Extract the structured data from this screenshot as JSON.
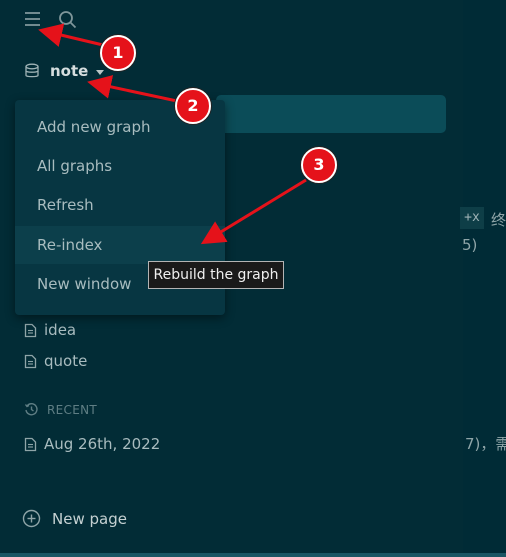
{
  "sidebar": {
    "graph_name": "note",
    "pages": [
      {
        "label": "idea"
      },
      {
        "label": "quote"
      }
    ],
    "recent": {
      "heading": "RECENT",
      "items": [
        {
          "label": "Aug 26th, 2022"
        }
      ]
    },
    "new_page_label": "New page"
  },
  "graph_menu": {
    "items": [
      {
        "label": "Add new graph"
      },
      {
        "label": "All graphs"
      },
      {
        "label": "Refresh"
      },
      {
        "label": "Re-index"
      },
      {
        "label": "New window"
      }
    ],
    "active_item": "Re-index",
    "tooltip": "Rebuild the graph"
  },
  "main": {
    "fragments": {
      "code": "+x",
      "char1": "终",
      "paren": "5)",
      "tail": "7)，需"
    }
  },
  "annotations": {
    "badges": [
      "1",
      "2",
      "3"
    ],
    "color": "#e5121a"
  },
  "icons": {
    "menu": "hamburger-menu-icon",
    "search": "search-icon",
    "graph": "database-icon",
    "page": "page-icon",
    "recent": "history-icon",
    "new_page": "plus-circle-icon"
  }
}
